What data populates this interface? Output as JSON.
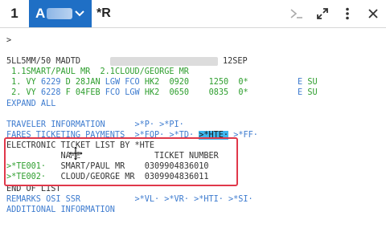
{
  "tabs": {
    "number": "1",
    "active_label": "A",
    "second_label": "*R"
  },
  "icons": {
    "expand_prompt": "prompt-icon",
    "maximize": "expand-arrows-icon",
    "more": "vertical-dots-icon",
    "close": "close-icon"
  },
  "terminal": {
    "prompt": ">",
    "header_left": "5LL5MM/50 MADTD",
    "header_date": "12SEP",
    "passengers": "1.1SMART/PAUL MR  2.1CLOUD/GEORGE MR",
    "seg1": {
      "num": " 1. VY",
      "flight": "6229",
      "cls": "D",
      "date": "28JAN",
      "route": "LGW FCO",
      "status": "HK2",
      "dep": "0920",
      "arr": "1250",
      "flag": "0*",
      "e": "E",
      "su": "SU"
    },
    "seg2": {
      "num": " 2. VY",
      "flight": "6228",
      "cls": "F",
      "date": "04FEB",
      "route": "FCO LGW",
      "status": "HK2",
      "dep": "0650",
      "arr": "0835",
      "flag": "0*",
      "e": "E",
      "su": "SU"
    },
    "expand_all": "EXPAND ALL",
    "traveler_info": "TRAVELER INFORMATION",
    "traveler_links": ">*P· >*PI·",
    "fares_info": "FARES TICKETING PAYMENTS",
    "fares_fop": ">*FOP·",
    "fares_td": ">*TD·",
    "fares_hte": ">*HTE·",
    "fares_ff": ">*FF·",
    "etl_title": "ELECTRONIC TICKET LIST BY *HTE",
    "etl_col_name": "NAME",
    "etl_col_ticket": "TICKET NUMBER",
    "etl_rows": [
      {
        "link": ">*TE001·",
        "name": "SMART/PAUL MR",
        "ticket": "0309904836010"
      },
      {
        "link": ">*TE002·",
        "name": "CLOUD/GEORGE MR",
        "ticket": "0309904836011"
      }
    ],
    "end_of_list": "END OF LIST",
    "remarks": "REMARKS OSI SSR",
    "remarks_links": ">*VL· >*VR· >*HTI· >*SI·",
    "additional_info": "ADDITIONAL INFORMATION"
  },
  "colors": {
    "tab_active": "#1f6fc5",
    "green_text": "#2e9e2e",
    "link_blue": "#3d7bcf",
    "highlight": "#3fb6ee",
    "red_box": "#e0384a"
  }
}
